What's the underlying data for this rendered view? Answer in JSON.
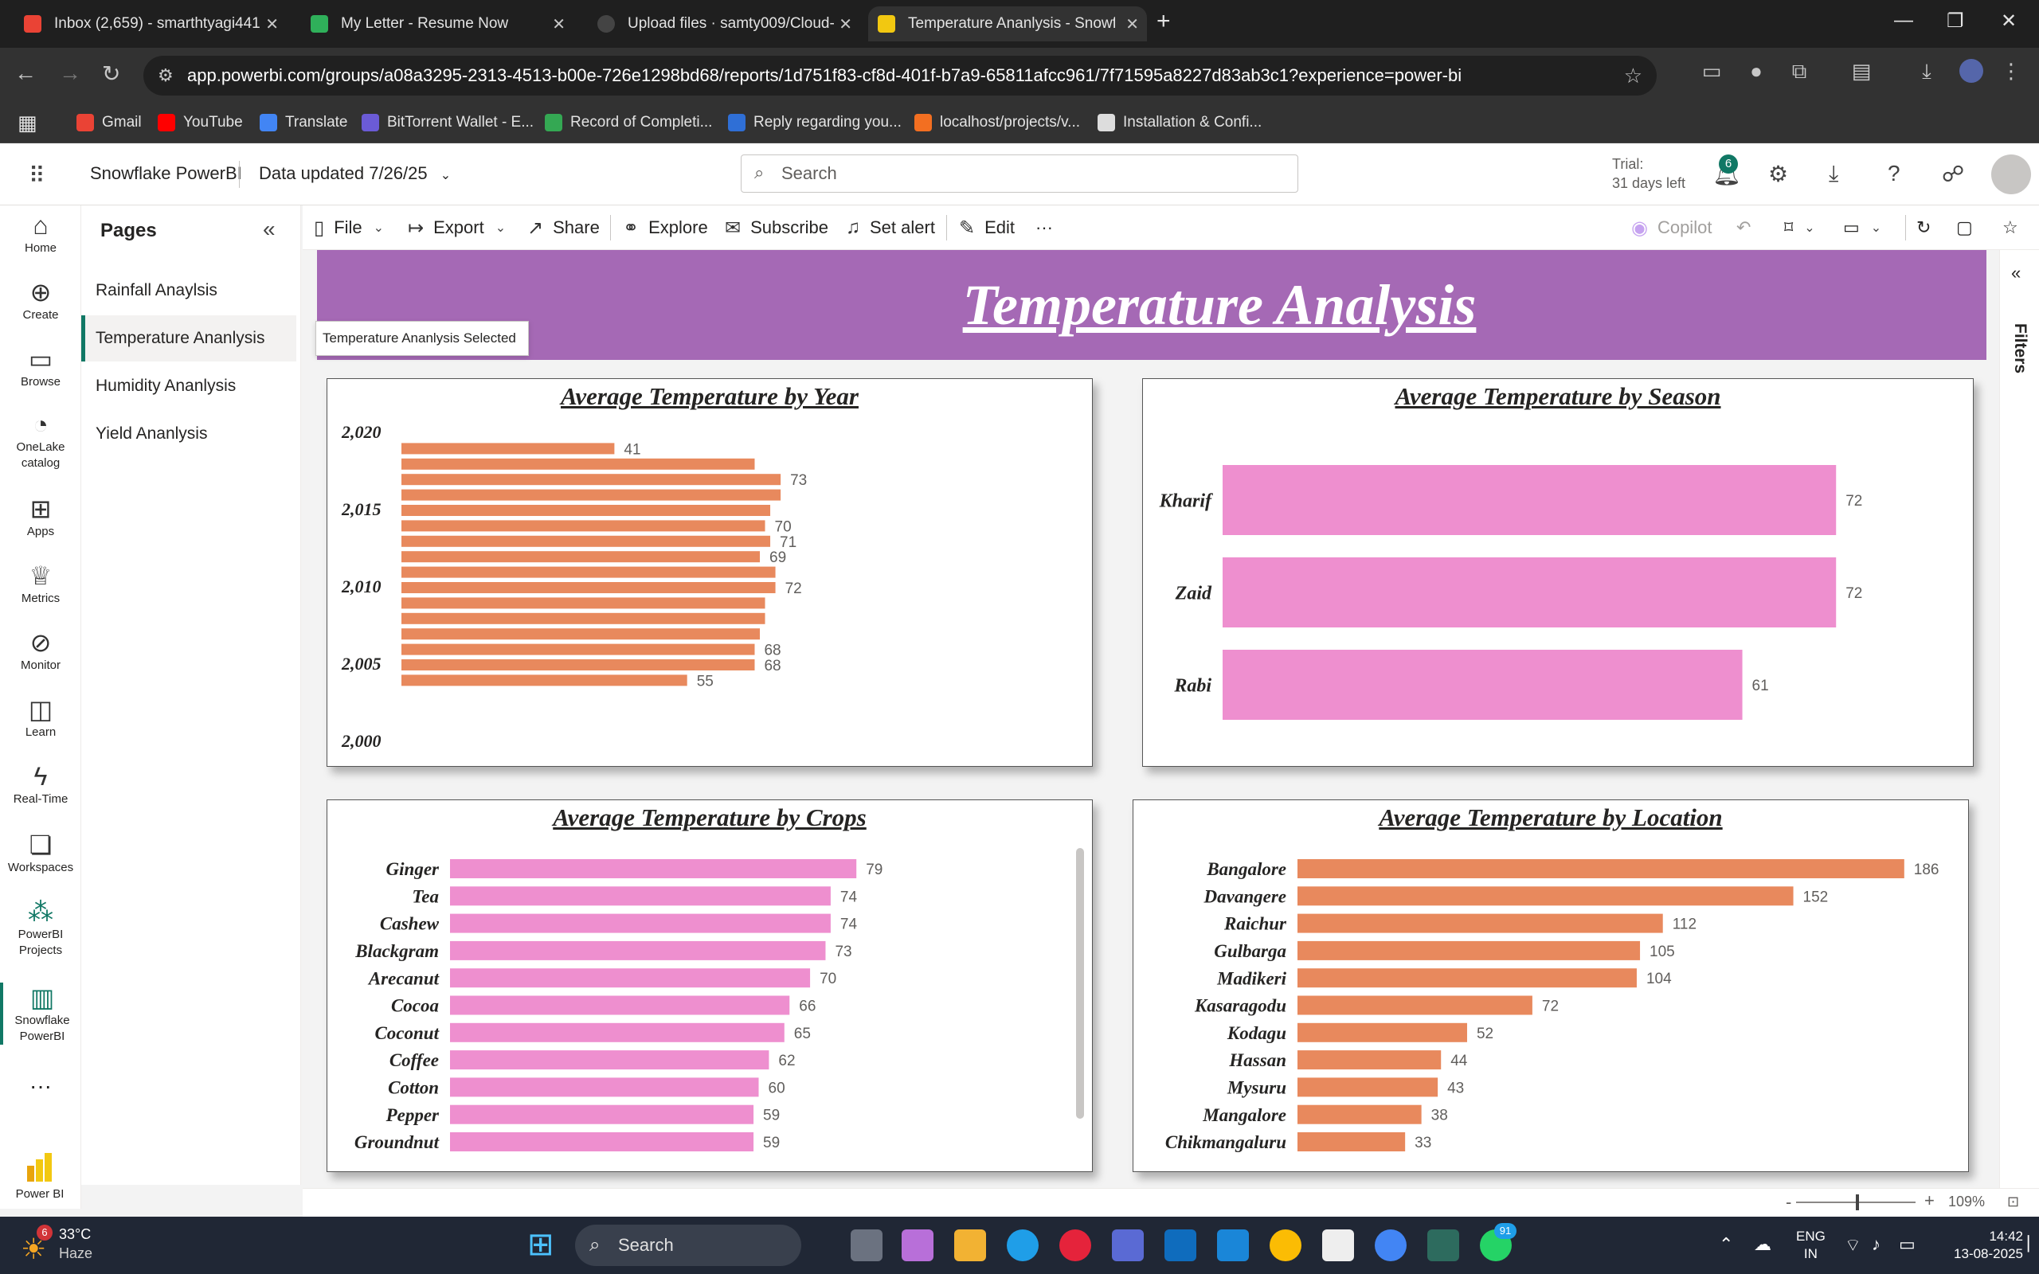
{
  "browser": {
    "tabs": [
      {
        "title": "Inbox (2,659) - smarthtyagi441",
        "icon_color": "#ea4335"
      },
      {
        "title": "My Letter - Resume Now",
        "icon_color": "#2fb05a"
      },
      {
        "title": "Upload files · samty009/Cloud-",
        "icon_color": "#444444"
      },
      {
        "title": "Temperature Ananlysis - Snowfl",
        "icon_color": "#f2c811"
      }
    ],
    "url": "app.powerbi.com/groups/a08a3295-2313-4513-b00e-726e1298bd68/reports/1d751f83-cf8d-401f-b7a9-65811afcc961/7f71595a8227d83ab3c1?experience=power-bi",
    "bookmarks": [
      {
        "label": "Gmail",
        "color": "#ea4335"
      },
      {
        "label": "YouTube",
        "color": "#ff0000"
      },
      {
        "label": "Translate",
        "color": "#4285f4"
      },
      {
        "label": "BitTorrent Wallet - E...",
        "color": "#6b5bd6"
      },
      {
        "label": "Record of Completi...",
        "color": "#34a853"
      },
      {
        "label": "Reply regarding you...",
        "color": "#2f6fd6"
      },
      {
        "label": "localhost/projects/v...",
        "color": "#f36f21"
      },
      {
        "label": "Installation & Confi...",
        "color": "#dddddd"
      }
    ]
  },
  "header": {
    "workspace": "Snowflake PowerBI",
    "data_updated": "Data updated 7/26/25",
    "search_placeholder": "Search",
    "trial_line1": "Trial:",
    "trial_line2": "31 days left",
    "notification_count": "6"
  },
  "leftnav": [
    {
      "label": "Home",
      "icon": "home-icon"
    },
    {
      "label": "Create",
      "icon": "plus-circle-icon"
    },
    {
      "label": "Browse",
      "icon": "folder-icon"
    },
    {
      "label": "OneLake catalog",
      "icon": "onelake-icon"
    },
    {
      "label": "Apps",
      "icon": "apps-icon"
    },
    {
      "label": "Metrics",
      "icon": "trophy-icon"
    },
    {
      "label": "Monitor",
      "icon": "monitor-icon"
    },
    {
      "label": "Learn",
      "icon": "book-icon"
    },
    {
      "label": "Real-Time",
      "icon": "lightning-icon"
    },
    {
      "label": "Workspaces",
      "icon": "workspaces-icon"
    },
    {
      "label": "PowerBI Projects",
      "icon": "projects-icon"
    },
    {
      "label": "Snowflake PowerBI",
      "icon": "report-icon"
    }
  ],
  "powerbi_brand": "Power BI",
  "pages": {
    "title": "Pages",
    "items": [
      "Rainfall Anaylsis",
      "Temperature Ananlysis",
      "Humidity Ananlysis",
      "Yield Ananlysis"
    ],
    "selected_index": 1,
    "tooltip": "Temperature Ananlysis Selected"
  },
  "toolbar": {
    "file": "File",
    "export": "Export",
    "share": "Share",
    "explore": "Explore",
    "subscribe": "Subscribe",
    "set_alert": "Set alert",
    "edit": "Edit",
    "more": "···",
    "copilot": "Copilot"
  },
  "report": {
    "title": "Temperature Analysis",
    "filters_label": "Filters",
    "zoom": "109%"
  },
  "chart_data": [
    {
      "type": "bar",
      "title": "Average Temperature by Year",
      "orientation": "horizontal",
      "y_axis_ticks": [
        "2,020",
        "2,015",
        "2,010",
        "2,005",
        "2,000"
      ],
      "ylim": [
        2000,
        2020
      ],
      "x": [
        2019,
        2018,
        2017,
        2016,
        2015,
        2014,
        2013,
        2012,
        2011,
        2010,
        2009,
        2008,
        2007,
        2006,
        2005,
        2004
      ],
      "values": [
        41,
        68,
        73,
        73,
        71,
        70,
        71,
        69,
        72,
        72,
        70,
        70,
        69,
        68,
        68,
        55
      ],
      "labeled_values": [
        41,
        73,
        70,
        71,
        69,
        72,
        68,
        68,
        55
      ],
      "color": "#e8895d"
    },
    {
      "type": "bar",
      "title": "Average Temperature by Season",
      "orientation": "horizontal",
      "categories": [
        "Kharif",
        "Zaid",
        "Rabi"
      ],
      "values": [
        72,
        72,
        61
      ],
      "color": "#ee8fcf"
    },
    {
      "type": "bar",
      "title": "Average Temperature by Crops",
      "orientation": "horizontal",
      "categories": [
        "Ginger",
        "Tea",
        "Cashew",
        "Blackgram",
        "Arecanut",
        "Cocoa",
        "Coconut",
        "Coffee",
        "Cotton",
        "Pepper",
        "Groundnut"
      ],
      "values": [
        79,
        74,
        74,
        73,
        70,
        66,
        65,
        62,
        60,
        59,
        59
      ],
      "color": "#ee8fcf"
    },
    {
      "type": "bar",
      "title": "Average Temperature by Location",
      "orientation": "horizontal",
      "categories": [
        "Bangalore",
        "Davangere",
        "Raichur",
        "Gulbarga",
        "Madikeri",
        "Kasaragodu",
        "Kodagu",
        "Hassan",
        "Mysuru",
        "Mangalore",
        "Chikmangaluru"
      ],
      "values": [
        186,
        152,
        112,
        105,
        104,
        72,
        52,
        44,
        43,
        38,
        33
      ],
      "color": "#e8895d"
    }
  ],
  "taskbar": {
    "weather_temp": "33°C",
    "weather_desc": "Haze",
    "weather_badge": "6",
    "search": "Search",
    "lang_line1": "ENG",
    "lang_line2": "IN",
    "time": "14:42",
    "date": "13-08-2025",
    "whatsapp_badge": "91"
  }
}
